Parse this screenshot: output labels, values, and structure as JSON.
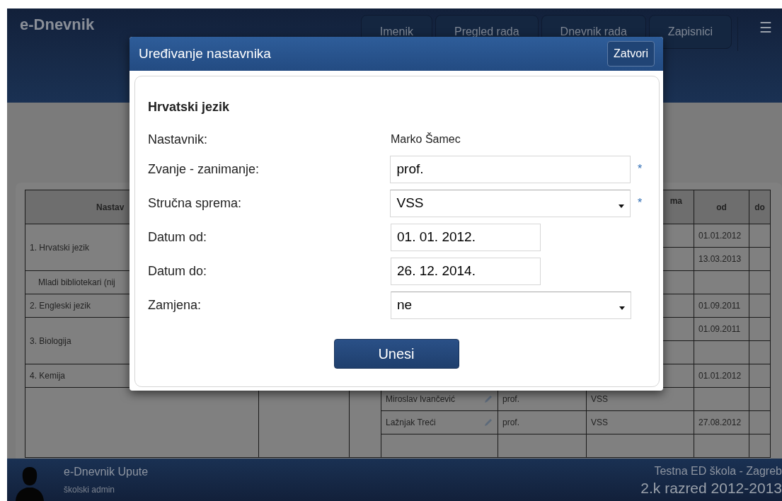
{
  "navbar": {
    "brand": "e-Dnevnik",
    "tabs": [
      {
        "label": "Imenik"
      },
      {
        "label": "Pregled rada"
      },
      {
        "label": "Dnevnik rada"
      },
      {
        "label": "Zapisnici"
      }
    ],
    "menu_icon": "☰"
  },
  "table": {
    "header": {
      "column_1": "Nastav",
      "column_6": "ma",
      "column_7": "od",
      "column_8": "do"
    },
    "groups": [
      {
        "kind": "subject",
        "name": "1. Hrvatski jezik",
        "entries": [
          {
            "kind": "date",
            "od": "01.01.2012"
          },
          {
            "kind": "date",
            "od": "13.03.2013"
          }
        ]
      },
      {
        "kind": "activity",
        "name": "Mladi bibliotekari (nij",
        "entries": [
          {
            "kind": "blank"
          }
        ]
      },
      {
        "kind": "subject",
        "name": "2. Engleski jezik",
        "entries": [
          {
            "kind": "date",
            "od": "01.09.2011"
          }
        ]
      },
      {
        "kind": "subject",
        "name": "3. Biologija",
        "entries": [
          {
            "kind": "date",
            "od": "01.09.2011"
          },
          {
            "kind": "blank"
          }
        ]
      },
      {
        "kind": "subject",
        "name": "4. Kemija",
        "entries": [
          {
            "kind": "date",
            "od": "01.01.2012"
          }
        ]
      },
      {
        "kind": "subject",
        "entries": [
          {
            "kind": "teacher",
            "teacher": "Miroslav Ivančević",
            "title": "prof.",
            "qualification": "VSS"
          },
          {
            "kind": "teacher",
            "teacher": "Lažnjak Treći",
            "title": "prof.",
            "qualification": "VSS",
            "od": "27.08.2012"
          },
          {
            "kind": "blank"
          }
        ]
      }
    ]
  },
  "modal": {
    "title": "Uređivanje nastavnika",
    "close_button": "Zatvori",
    "subject": "Hrvatski jezik",
    "fields": [
      {
        "kind": "text",
        "label": "Nastavnik:",
        "value": "Marko Šamec",
        "required": false
      },
      {
        "kind": "input",
        "label": "Zvanje - zanimanje:",
        "value": "prof.",
        "required": true
      },
      {
        "kind": "select",
        "label": "Stručna sprema:",
        "value": "VSS",
        "required": true
      },
      {
        "kind": "date",
        "label": "Datum od:",
        "value": "01. 01. 2012.",
        "required": false
      },
      {
        "kind": "date",
        "label": "Datum do:",
        "value": "26. 12. 2014.",
        "required": false
      },
      {
        "kind": "select",
        "label": "Zamjena:",
        "value": "ne",
        "required": false
      }
    ],
    "required_mark": "*",
    "submit_button": "Unesi"
  },
  "footer": {
    "title": "e-Dnevnik Upute",
    "role": "školski admin",
    "school": "Testna ED škola - Zagreb",
    "class": "2.k razred 2012-2013"
  }
}
